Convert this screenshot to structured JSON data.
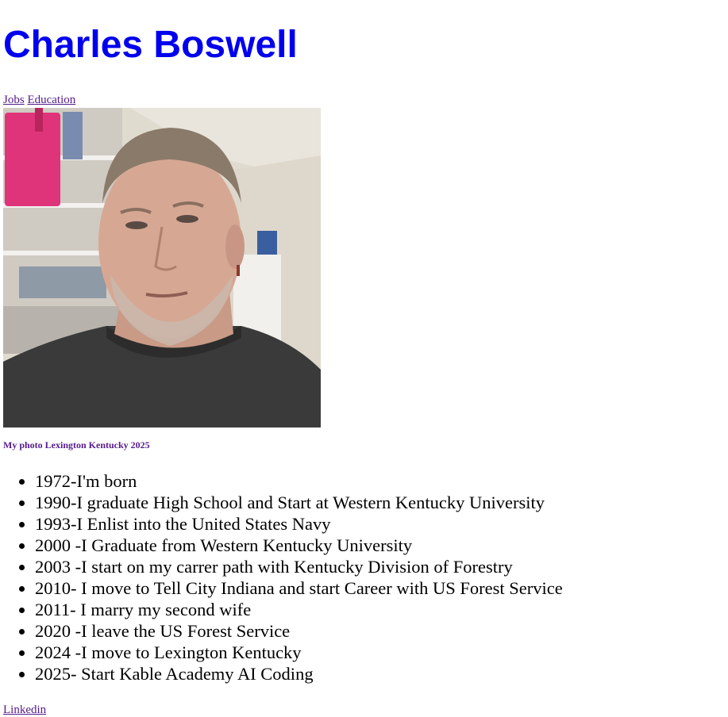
{
  "header": {
    "title": "Charles Boswell",
    "title_color": "#0000ee"
  },
  "nav": {
    "links": [
      {
        "label": "Jobs"
      },
      {
        "label": "Education"
      }
    ],
    "visited_link_color": "#551a8b"
  },
  "photo": {
    "caption": "My photo Lexington Kentucky 2025"
  },
  "timeline": {
    "items": [
      {
        "text": "1972-I'm born"
      },
      {
        "text": "1990-I graduate High School and Start at Western Kentucky University"
      },
      {
        "text": "1993-I Enlist into the United States Navy"
      },
      {
        "text": "2000 -I Graduate from Western Kentucky University"
      },
      {
        "text": "2003 -I start on my carrer path with Kentucky Division of Forestry"
      },
      {
        "text": "2010- I move to Tell City Indiana and start Career with US Forest Service"
      },
      {
        "text": "2011- I marry my second wife"
      },
      {
        "text": "2020 -I leave the US Forest Service"
      },
      {
        "text": "2024 -I move to Lexington Kentucky"
      },
      {
        "text": "2025- Start Kable Academy AI Coding"
      }
    ]
  },
  "footer": {
    "link_label": "Linkedin"
  }
}
